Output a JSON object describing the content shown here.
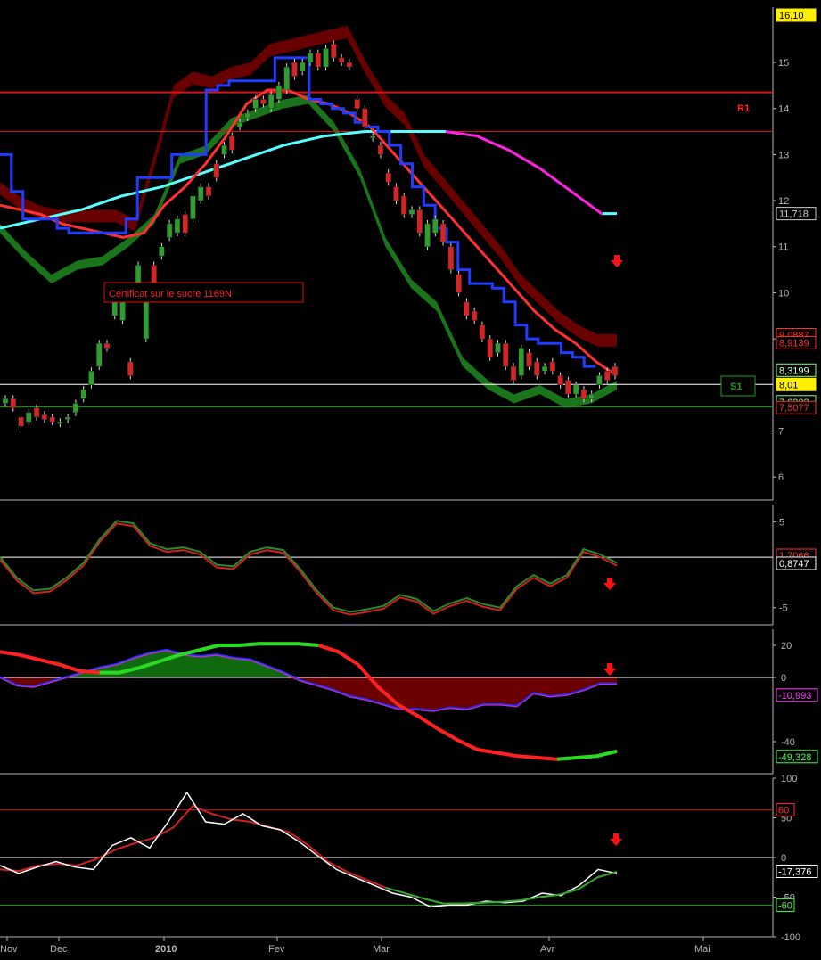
{
  "colors": {
    "background": "#000000",
    "axis": "#b5b5b5",
    "price_up": "#2e9e2e",
    "price_down": "#d42424",
    "ma_blue": "#1f3cff",
    "ma_red": "#ff3030",
    "ma_cyan": "#55ffff",
    "ma_magenta": "#ff22e0",
    "band_upper": "#6e0000",
    "band_lower": "#1b7a1b",
    "resistance": "#e01010",
    "support": "#1aa01a",
    "current_line": "#ffffff",
    "label_yellow": "#ffee00"
  },
  "annotation": {
    "text": "Certificat sur le sucre 1169N"
  },
  "levels": {
    "r1_label": "R1",
    "s1_label": "S1"
  },
  "x_axis": {
    "labels": [
      "Nov",
      "Dec",
      "2010",
      "Fev",
      "Mar",
      "Avr",
      "Mai"
    ]
  },
  "chart_data": [
    {
      "type": "line",
      "name": "price",
      "ylim": [
        5.5,
        16.2
      ],
      "yticks": [
        "15",
        "14",
        "13",
        "12",
        "11",
        "10",
        "9",
        "7",
        "6"
      ],
      "price_labels": [
        "16,10",
        "11,718",
        "9,0887",
        "8,9139",
        "8,3199",
        "8,01",
        "7,6323",
        "7,5077"
      ],
      "resistance_levels": [
        14.35,
        13.5
      ],
      "support_level": 7.52,
      "current_price": 8.01,
      "candles": [
        [
          7.6,
          7.7
        ],
        [
          7.7,
          7.5
        ],
        [
          7.3,
          7.1
        ],
        [
          7.2,
          7.4
        ],
        [
          7.5,
          7.3
        ],
        [
          7.35,
          7.25
        ],
        [
          7.3,
          7.2
        ],
        [
          7.2,
          7.2
        ],
        [
          7.25,
          7.3
        ],
        [
          7.4,
          7.6
        ],
        [
          7.7,
          7.9
        ],
        [
          8.0,
          8.3
        ],
        [
          8.4,
          8.9
        ],
        [
          8.9,
          8.8
        ],
        [
          9.5,
          9.9
        ],
        [
          9.4,
          9.8
        ],
        [
          8.5,
          8.2
        ],
        [
          9.9,
          10.6
        ],
        [
          9.0,
          10.0
        ],
        [
          10.6,
          10.2
        ],
        [
          10.8,
          11.0
        ],
        [
          11.2,
          11.5
        ],
        [
          11.3,
          11.6
        ],
        [
          11.7,
          11.3
        ],
        [
          11.6,
          12.1
        ],
        [
          12.0,
          12.3
        ],
        [
          12.3,
          12.1
        ],
        [
          12.8,
          12.5
        ],
        [
          13.0,
          13.2
        ],
        [
          13.4,
          13.1
        ],
        [
          13.6,
          13.7
        ],
        [
          13.8,
          13.9
        ],
        [
          14.0,
          14.2
        ],
        [
          14.2,
          14.1
        ],
        [
          14.0,
          14.3
        ],
        [
          14.2,
          14.5
        ],
        [
          14.4,
          14.9
        ],
        [
          15.0,
          14.7
        ],
        [
          14.8,
          15.0
        ],
        [
          15.0,
          15.2
        ],
        [
          15.2,
          14.9
        ],
        [
          14.9,
          15.3
        ],
        [
          15.4,
          15.1
        ],
        [
          15.1,
          15.0
        ],
        [
          15.0,
          14.9
        ],
        [
          14.2,
          14.0
        ],
        [
          14.0,
          13.6
        ],
        [
          13.4,
          13.4
        ],
        [
          13.2,
          13.0
        ],
        [
          12.6,
          12.4
        ],
        [
          12.3,
          12.0
        ],
        [
          12.1,
          11.7
        ],
        [
          11.7,
          11.8
        ],
        [
          11.8,
          11.3
        ],
        [
          11.0,
          11.5
        ],
        [
          11.3,
          11.6
        ],
        [
          11.5,
          11.1
        ],
        [
          11.0,
          10.5
        ],
        [
          10.4,
          10.0
        ],
        [
          9.8,
          9.5
        ],
        [
          9.6,
          9.4
        ],
        [
          9.3,
          9.0
        ],
        [
          9.0,
          8.6
        ],
        [
          8.7,
          8.9
        ],
        [
          8.9,
          8.4
        ],
        [
          8.4,
          8.1
        ],
        [
          8.2,
          8.8
        ],
        [
          8.7,
          8.4
        ],
        [
          8.5,
          8.2
        ],
        [
          8.3,
          8.4
        ],
        [
          8.5,
          8.3
        ],
        [
          8.2,
          8.0
        ],
        [
          8.1,
          7.8
        ],
        [
          7.8,
          8.0
        ],
        [
          7.9,
          7.7
        ],
        [
          7.7,
          7.8
        ],
        [
          8.0,
          8.2
        ],
        [
          8.3,
          8.1
        ],
        [
          8.4,
          8.2
        ]
      ],
      "ma_blue": [
        13.0,
        12.2,
        11.6,
        11.6,
        11.6,
        11.4,
        11.3,
        11.3,
        11.3,
        11.3,
        11.3,
        11.6,
        12.5,
        12.5,
        12.5,
        13.0,
        13.0,
        13.0,
        14.4,
        14.5,
        14.6,
        14.6,
        14.6,
        14.6,
        15.1,
        15.1,
        15.1,
        14.2,
        14.1,
        14.0,
        13.9,
        13.7,
        13.6,
        13.5,
        13.2,
        12.8,
        12.3,
        11.9,
        11.4,
        11.1,
        10.5,
        10.2,
        10.2,
        10.1,
        9.8,
        9.3,
        9.0,
        8.9,
        8.9,
        8.7,
        8.6,
        8.4,
        8.4
      ],
      "ma_red": [
        11.9,
        11.8,
        11.7,
        11.5,
        11.4,
        11.3,
        11.2,
        11.3,
        11.9,
        12.3,
        12.8,
        13.4,
        14.1,
        14.4,
        14.4,
        14.2,
        14.1,
        13.9,
        13.6,
        13.1,
        12.6,
        12.1,
        11.6,
        11.1,
        10.6,
        10.1,
        9.6,
        9.2,
        8.9,
        8.5,
        8.2
      ],
      "ma_cyan": [
        11.4,
        11.6,
        11.8,
        12.1,
        12.3,
        12.6,
        12.9,
        13.2,
        13.4,
        13.5,
        13.5,
        13.5
      ],
      "ma_magenta": [
        13.5,
        13.4,
        13.1,
        12.7,
        12.2,
        11.7
      ],
      "band_upper": [
        12.4,
        12.1,
        11.9,
        11.8,
        11.8,
        11.8,
        11.8,
        11.6,
        13.0,
        14.5,
        14.8,
        14.7,
        14.9,
        15.0,
        15.4,
        15.5,
        15.6,
        15.7,
        15.8,
        15.0,
        14.3,
        13.9,
        13.0,
        12.5,
        12.0,
        11.5,
        11.0,
        10.4,
        10.0,
        9.6,
        9.3,
        9.1,
        9.1
      ],
      "band_lower": [
        11.3,
        10.7,
        10.2,
        10.5,
        10.6,
        11.0,
        11.5,
        12.8,
        13.0,
        13.6,
        13.8,
        14.0,
        14.1,
        13.5,
        12.5,
        11.0,
        10.1,
        9.6,
        8.4,
        7.9,
        7.6,
        7.8,
        7.5,
        7.6,
        7.9
      ]
    },
    {
      "type": "line",
      "name": "oscillator_1",
      "ylim": [
        -7,
        7
      ],
      "yticks": [
        "5",
        "-5"
      ],
      "value_labels": [
        "1,7066",
        "0,8747"
      ],
      "zero_line": 0.8747,
      "series": [
        {
          "values": [
            0.9,
            -1.5,
            -3.0,
            -2.8,
            -1.5,
            0.2,
            3.0,
            5.1,
            4.8,
            2.5,
            1.8,
            2.0,
            1.5,
            0,
            -0.2,
            1.5,
            2.0,
            1.7,
            -0.5,
            -3.0,
            -5.0,
            -5.5,
            -5.2,
            -4.8,
            -3.5,
            -4.0,
            -5.4,
            -4.5,
            -3.9,
            -4.6,
            -5.0,
            -2.5,
            -1.2,
            -2.2,
            -1.2,
            1.8,
            1.2,
            0.2
          ]
        }
      ]
    },
    {
      "type": "area",
      "name": "oscillator_2",
      "ylim": [
        -60,
        30
      ],
      "yticks": [
        "20",
        "0",
        "-40"
      ],
      "value_labels": [
        "-10,993",
        "-49,328"
      ],
      "series": [
        {
          "values": [
            0,
            -5,
            -6,
            -3,
            0,
            3,
            6,
            8,
            12,
            15,
            17,
            14,
            13,
            14,
            12,
            11,
            7,
            3,
            -2,
            -5,
            -8,
            -12,
            -14,
            -17,
            -20,
            -20,
            -21,
            -19,
            -20,
            -17,
            -17,
            -18,
            -10,
            -12,
            -11,
            -8,
            -4,
            -4
          ]
        },
        {
          "values": [
            16,
            14,
            11,
            8,
            4,
            3,
            3,
            6,
            10,
            14,
            17,
            20,
            20,
            21,
            21,
            21,
            20,
            16,
            8,
            -6,
            -17,
            -24,
            -32,
            -39,
            -45,
            -47,
            -49,
            -50,
            -51,
            -50,
            -49,
            -46
          ]
        }
      ]
    },
    {
      "type": "line",
      "name": "oscillator_3",
      "ylim": [
        -100,
        100
      ],
      "yticks": [
        "100",
        "50",
        "0",
        "-50",
        "-100"
      ],
      "value_labels": [
        "60",
        "-17,376",
        "-60"
      ],
      "levels": [
        60,
        0,
        -60
      ],
      "series": [
        {
          "values": [
            -10,
            -20,
            -12,
            -5,
            -12,
            -15,
            15,
            25,
            12,
            45,
            82,
            45,
            42,
            55,
            40,
            35,
            20,
            2,
            -15,
            -25,
            -35,
            -45,
            -50,
            -62,
            -60,
            -60,
            -55,
            -57,
            -55,
            -45,
            -48,
            -35,
            -15,
            -20
          ]
        },
        {
          "values": [
            -15,
            -17,
            -10,
            -8,
            -10,
            -2,
            10,
            18,
            25,
            38,
            65,
            55,
            48,
            45,
            38,
            32,
            15,
            -5,
            -18,
            -28,
            -38,
            -45,
            -52,
            -58,
            -58,
            -57,
            -56,
            -54,
            -50,
            -47,
            -40,
            -25,
            -18
          ]
        }
      ]
    }
  ]
}
